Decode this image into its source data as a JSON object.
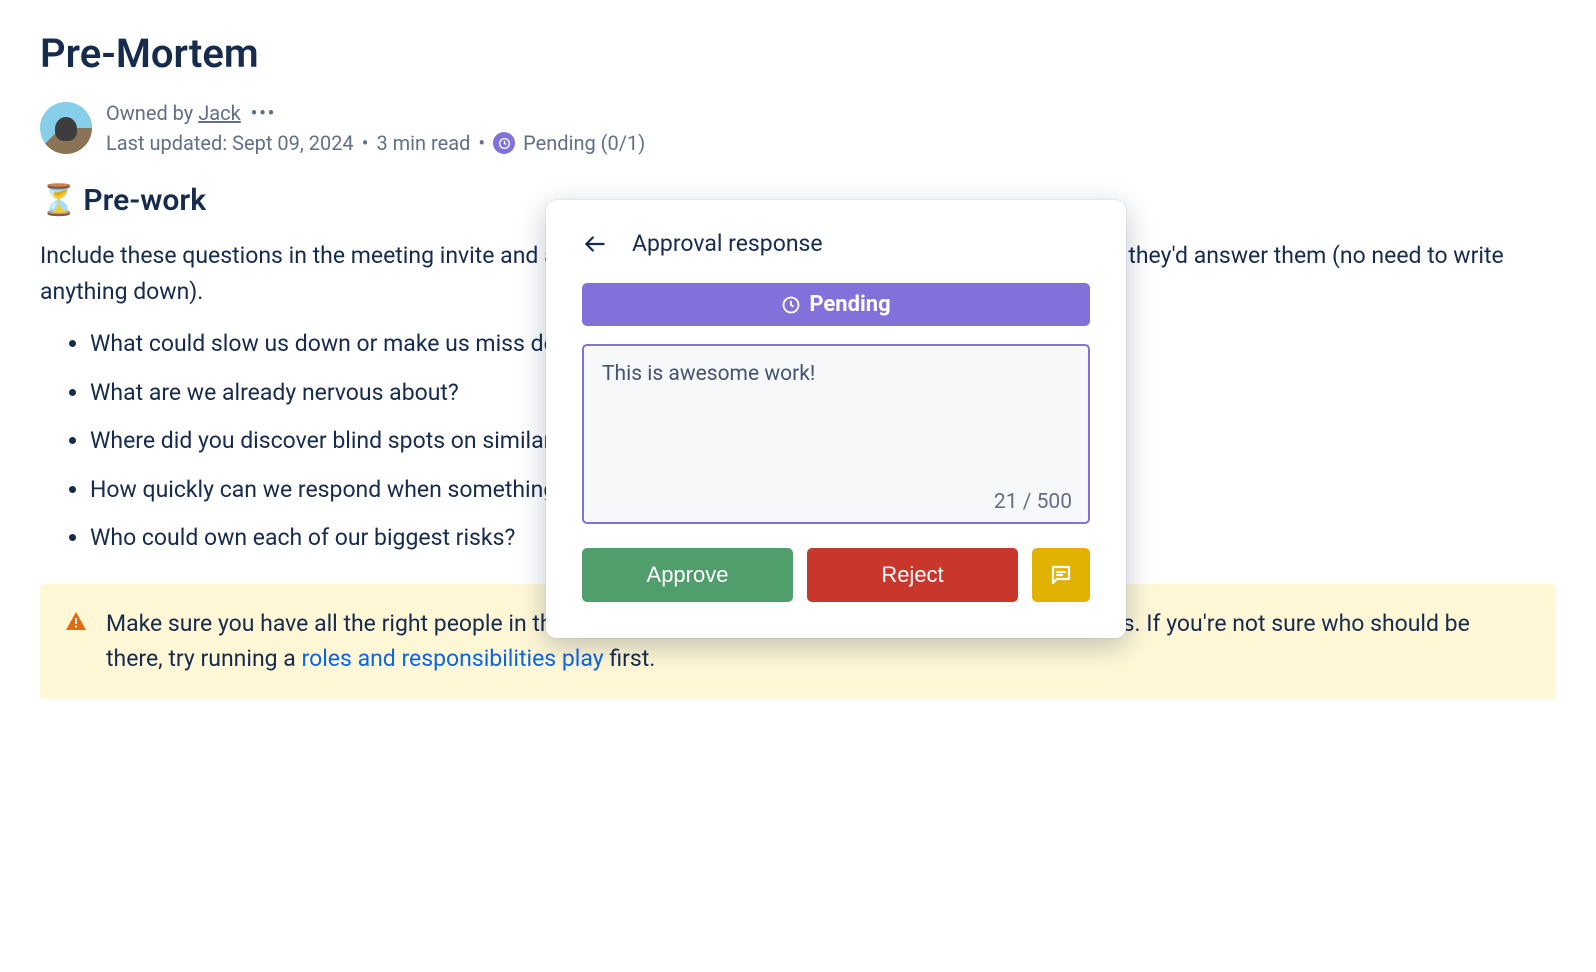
{
  "page": {
    "title": "Pre-Mortem"
  },
  "meta": {
    "owned_by_prefix": "Owned by ",
    "owner_name": "Jack",
    "last_updated": "Last updated: Sept 09, 2024",
    "read_time": "3 min read",
    "pending_label": "Pending (0/1)"
  },
  "section": {
    "heading_emoji": "⏳",
    "heading_text": "Pre-work",
    "intro": "Include these questions in the meeting invite and ask attendees to spend 10 minutes thinking through how they'd answer them (no need to write anything down)."
  },
  "bullets": [
    "What could slow us down or make us miss deadlines?",
    "What are we already nervous about?",
    "Where did you discover blind spots on similar past projects?",
    "How quickly can we respond when something goes wrong?",
    "Who could own each of our biggest risks?"
  ],
  "note": {
    "prefix": "Make sure you have all the right people in the room who can speak to your most significant risk areas. If you're not sure who should be there, try running a ",
    "link_text": "roles and responsibilities play",
    "suffix": " first."
  },
  "popup": {
    "title": "Approval response",
    "banner": "Pending",
    "comment_value": "This is awesome work!",
    "char_count": "21 / 500",
    "approve_label": "Approve",
    "reject_label": "Reject"
  }
}
